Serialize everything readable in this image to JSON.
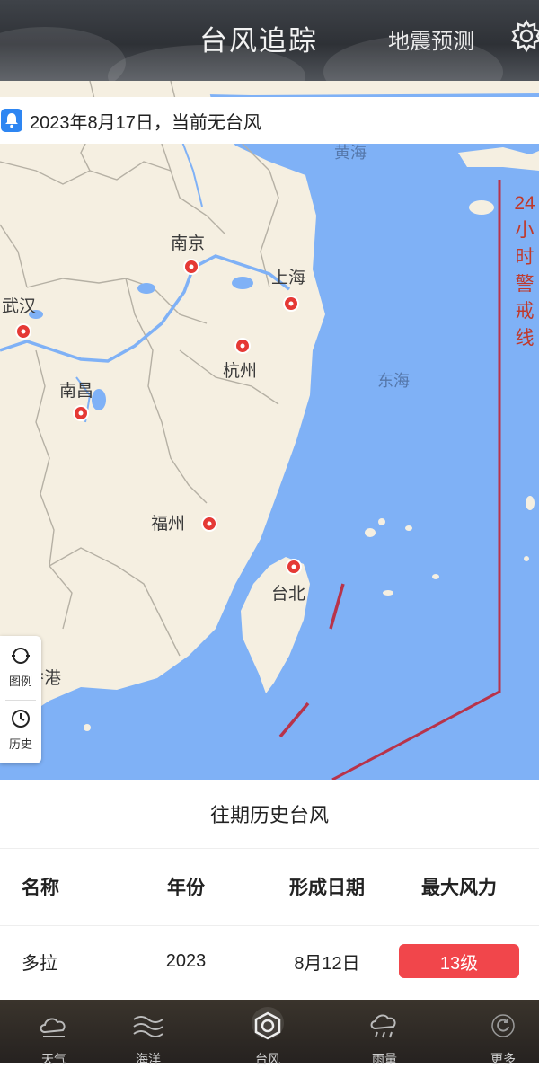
{
  "header": {
    "title": "台风追踪",
    "quake_link": "地震预测"
  },
  "notice": {
    "text": "2023年8月17日，当前无台风"
  },
  "map": {
    "cities": {
      "nanjing": "南京",
      "shanghai": "上海",
      "wuhan": "武汉",
      "hangzhou": "杭州",
      "nanchang": "南昌",
      "fuzhou": "福州",
      "taipei": "台北",
      "hongkong": "香港"
    },
    "seas": {
      "east_sea": "东海",
      "yellow_sea": "黄海"
    },
    "warning_line_label": "24小时警戒线",
    "tools": {
      "legend": "图例",
      "history": "历史"
    },
    "colors": {
      "sea": "#7fb1f6",
      "land": "#f5efe1",
      "river": "#7fb1f6",
      "warning_line": "#b8334a",
      "city_marker": "#e53935"
    }
  },
  "history": {
    "title": "往期历史台风",
    "columns": [
      "名称",
      "年份",
      "形成日期",
      "最大风力"
    ],
    "rows": [
      {
        "name": "多拉",
        "year": "2023",
        "date": "8月12日",
        "level": "13级"
      }
    ]
  },
  "nav": {
    "items": [
      {
        "label": "天气",
        "icon": "cloud-icon"
      },
      {
        "label": "海洋",
        "icon": "waves-icon"
      },
      {
        "label": "台风",
        "icon": "typhoon-icon"
      },
      {
        "label": "雨量",
        "icon": "rain-cloud-icon"
      },
      {
        "label": "更多",
        "icon": "refresh-icon"
      }
    ],
    "active_index": 2
  }
}
